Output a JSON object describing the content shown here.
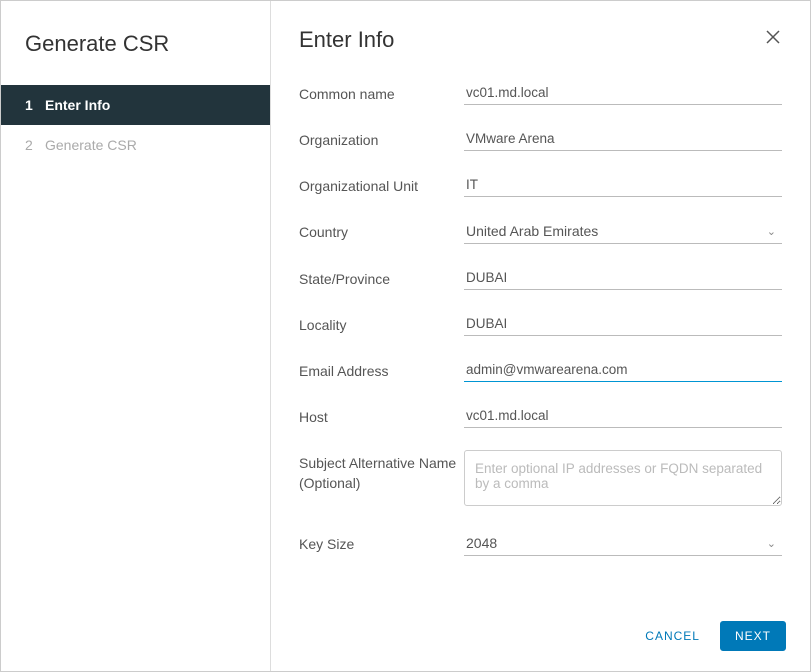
{
  "sidebar": {
    "title": "Generate CSR",
    "steps": [
      {
        "num": "1",
        "label": "Enter Info"
      },
      {
        "num": "2",
        "label": "Generate CSR"
      }
    ]
  },
  "header": {
    "title": "Enter Info"
  },
  "form": {
    "commonName": {
      "label": "Common name",
      "value": "vc01.md.local"
    },
    "organization": {
      "label": "Organization",
      "value": "VMware Arena"
    },
    "orgUnit": {
      "label": "Organizational Unit",
      "value": "IT"
    },
    "country": {
      "label": "Country",
      "value": "United Arab Emirates"
    },
    "state": {
      "label": "State/Province",
      "value": "DUBAI"
    },
    "locality": {
      "label": "Locality",
      "value": "DUBAI"
    },
    "email": {
      "label": "Email Address",
      "value": "admin@vmwarearena.com"
    },
    "host": {
      "label": "Host",
      "value": "vc01.md.local"
    },
    "san": {
      "label": "Subject Alternative Name (Optional)",
      "placeholder": "Enter optional IP addresses or FQDN separated by a comma"
    },
    "keySize": {
      "label": "Key Size",
      "value": "2048"
    }
  },
  "footer": {
    "cancel": "CANCEL",
    "next": "NEXT"
  }
}
